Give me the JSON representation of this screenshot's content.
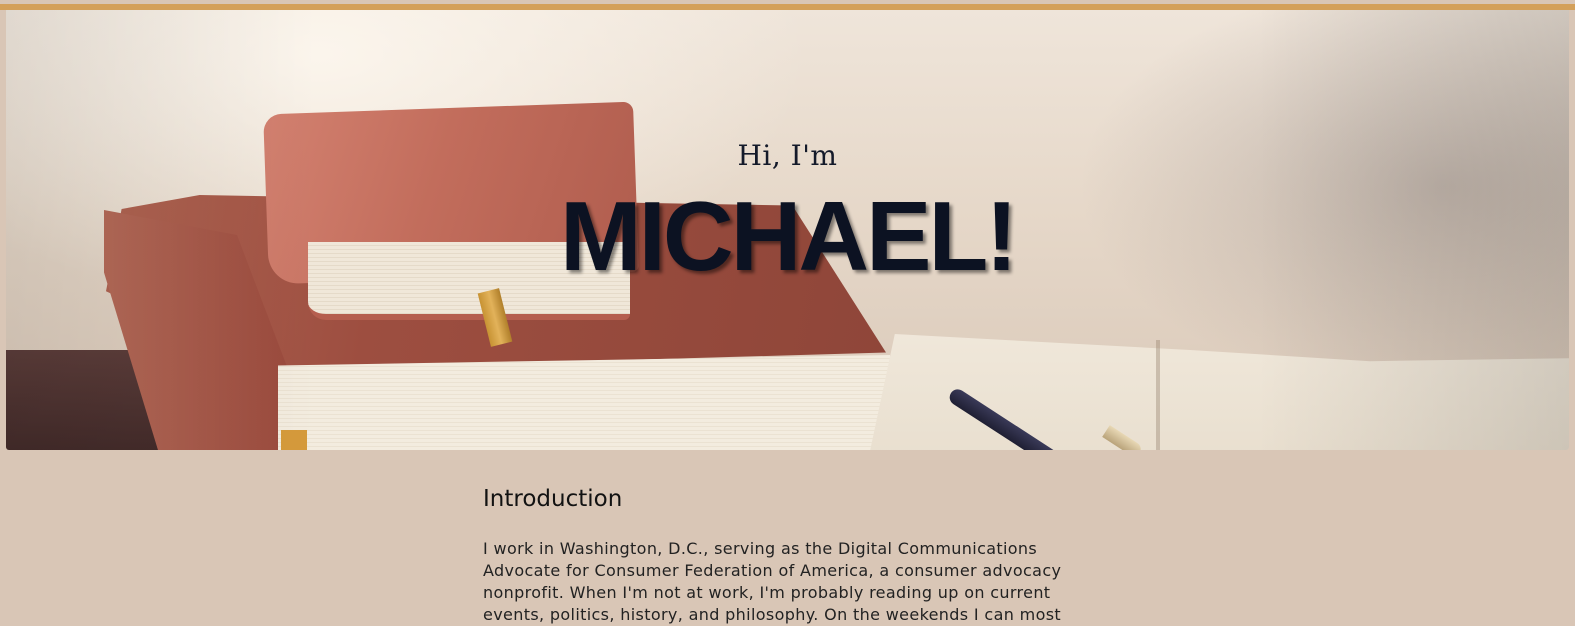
{
  "colors": {
    "accent_bar": "#d4a05a",
    "page_background": "#d9c6b6",
    "hero_title": "#0c1222"
  },
  "hero": {
    "greeting": "Hi, I'm",
    "name": "MICHAEL!",
    "image_description_icon": "books-and-pen-photo"
  },
  "introduction": {
    "title": "Introduction",
    "body": "I work in Washington, D.C., serving as the Digital Communications Advocate for Consumer Federation of America, a consumer advocacy nonprofit. When I'm not at work, I'm probably reading up on current events, politics, history, and philosophy. On the weekends I can most"
  }
}
